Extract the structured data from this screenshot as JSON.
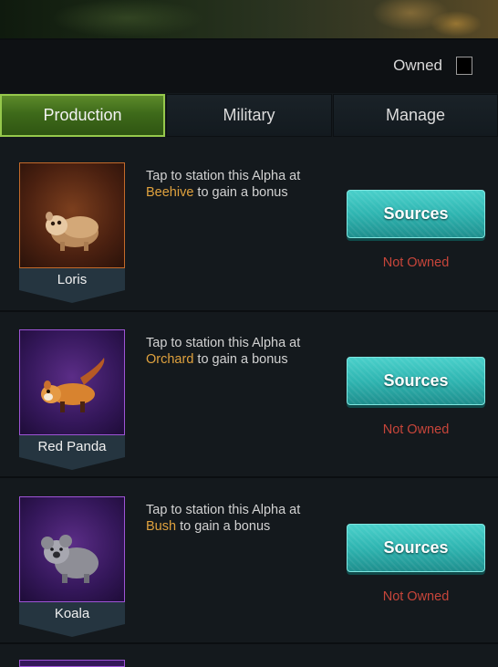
{
  "header": {
    "owned_label": "Owned",
    "owned_checked": false
  },
  "tabs": [
    {
      "label": "Production",
      "active": true
    },
    {
      "label": "Military",
      "active": false
    },
    {
      "label": "Manage",
      "active": false
    }
  ],
  "alphas": [
    {
      "name": "Loris",
      "frame_color": "#c46a2a",
      "desc_before": "Tap to station this Alpha at",
      "place": "Beehive",
      "desc_after": " to gain a bonus",
      "button_label": "Sources",
      "status": "Not Owned"
    },
    {
      "name": "Red Panda",
      "frame_color": "#9e54d6",
      "desc_before": "Tap to station this Alpha at",
      "place": "Orchard",
      "desc_after": " to gain a bonus",
      "button_label": "Sources",
      "status": "Not Owned"
    },
    {
      "name": "Koala",
      "frame_color": "#9e54d6",
      "desc_before": "Tap to station this Alpha at",
      "place": "Bush",
      "desc_after": " to gain a bonus",
      "button_label": "Sources",
      "status": "Not Owned"
    }
  ],
  "colors": {
    "accent_green": "#96c84c",
    "button_teal": "#2fb5b1",
    "place_highlight": "#e0a23e",
    "status_red": "#c7453a"
  }
}
